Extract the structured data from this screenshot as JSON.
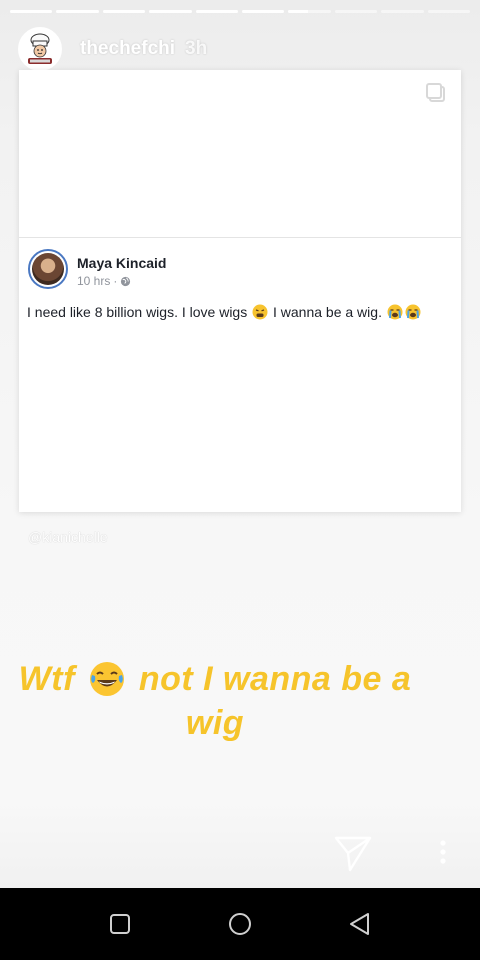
{
  "story": {
    "segments_total": 10,
    "segments_complete": 6,
    "current_segment_progress": 0.45,
    "username": "thechefchi",
    "time_ago": "3h",
    "avatar_icon": "chef-avatar-icon",
    "shared_post": {
      "author": "Maya Kincaid",
      "time": "10 hrs",
      "separator": "·",
      "privacy_icon": "globe-icon",
      "text_parts": [
        "I need like 8 billion wigs. I love wigs ",
        " I wanna be a wig. "
      ],
      "emojis": [
        "tired-face-emoji",
        "crying-face-emoji",
        "crying-face-emoji"
      ]
    },
    "watermark": "@kianichelle",
    "caption": {
      "line1_before": "Wtf",
      "line1_after": "not I wanna be a",
      "line2": "wig",
      "emoji": "laughing-tears-emoji",
      "color": "#f6c42b"
    }
  },
  "actions": {
    "send_icon": "send-icon",
    "more_icon": "more-vertical-icon"
  },
  "navbar": {
    "recents_icon": "square-icon",
    "home_icon": "circle-icon",
    "back_icon": "triangle-back-icon"
  }
}
